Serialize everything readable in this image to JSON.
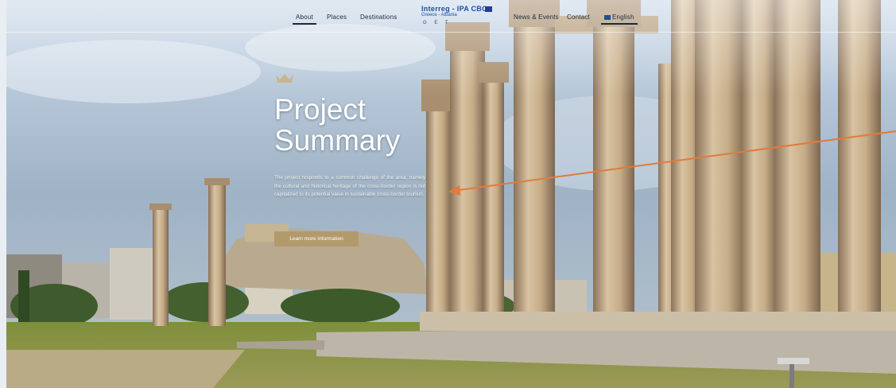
{
  "nav": {
    "items": [
      "About",
      "Places",
      "Destinations",
      "News & Events",
      "Contact"
    ],
    "active": "About",
    "language": "English"
  },
  "logo": {
    "title": "Interreg - IPA CBC",
    "subtitle": "Greece - Albania",
    "project": "G E T"
  },
  "hero": {
    "title_line1": "Project",
    "title_line2": "Summary",
    "summary": "The project responds to a common challenge of the area, namely the cultural and historical heritage of the cross-border region is not capitalized to its potential value in sustainable cross-border tourism.",
    "cta_label": "Learn more Information"
  },
  "colors": {
    "accent_button": "#b39a6c",
    "nav_text": "#1e2a3a",
    "logo_blue": "#1d4fa1",
    "annotation_arrow": "#e07b3c"
  },
  "icons": [
    "crown-icon",
    "eu-flag-icon",
    "language-flag-icon"
  ]
}
